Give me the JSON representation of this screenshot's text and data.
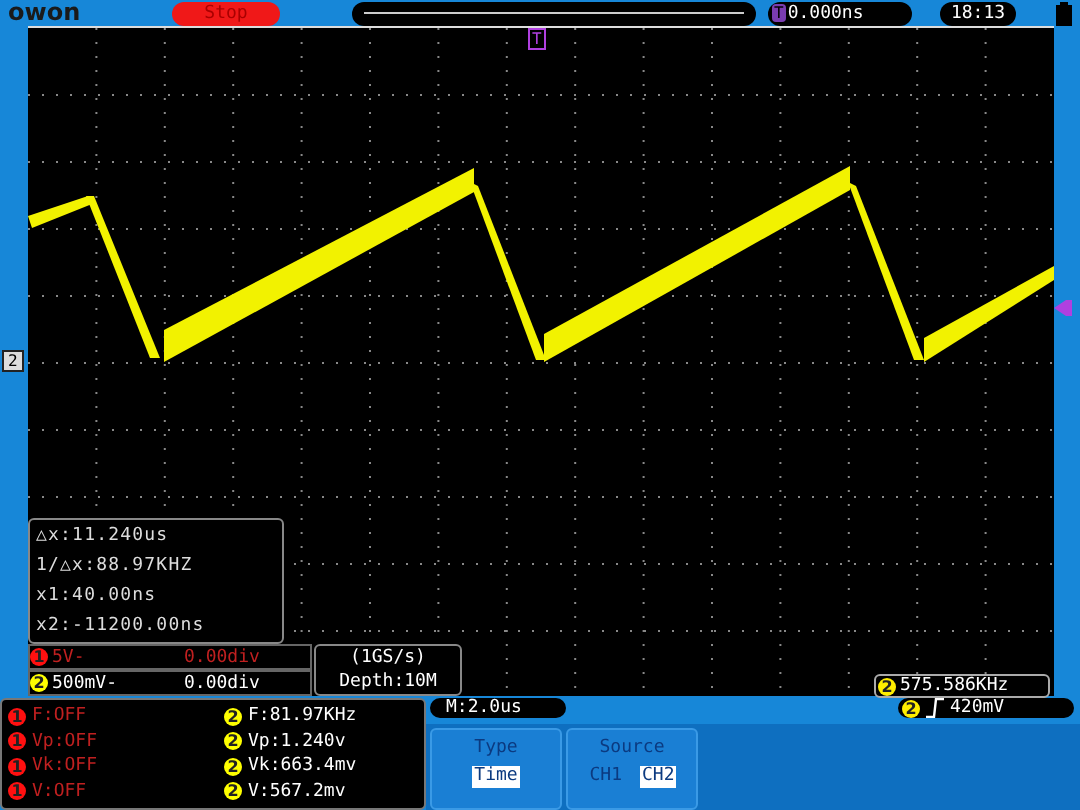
{
  "header": {
    "logo": "owon",
    "run_state": "Stop",
    "trigger_marker": "T",
    "trigger_time": "0.000ns",
    "clock": "18:13"
  },
  "display": {
    "ground_marker": "2",
    "top_marker": "T",
    "cursor_readout": [
      "△x:11.240us",
      "1/△x:88.97KHZ",
      "x1:40.00ns",
      "x2:-11200.00ns"
    ],
    "channels": [
      {
        "number": "1",
        "scale": "5V-",
        "offset": "0.00div",
        "color": "#ff1010",
        "enabled": false
      },
      {
        "number": "2",
        "scale": "500mV-",
        "offset": "0.00div",
        "color": "#ffff00",
        "enabled": true
      }
    ],
    "sample_rate": "(1GS/s)",
    "depth": "Depth:10M",
    "frequency": {
      "channel": "2",
      "value": "575.586KHz"
    }
  },
  "measurements": [
    {
      "channel": "1",
      "color": "#ff1010",
      "enabled": false,
      "value": "F:OFF"
    },
    {
      "channel": "1",
      "color": "#ff1010",
      "enabled": false,
      "value": "Vp:OFF"
    },
    {
      "channel": "1",
      "color": "#ff1010",
      "enabled": false,
      "value": "Vk:OFF"
    },
    {
      "channel": "1",
      "color": "#ff1010",
      "enabled": false,
      "value": "V:OFF"
    },
    {
      "channel": "2",
      "color": "#ffff00",
      "enabled": true,
      "value": "F:81.97KHz"
    },
    {
      "channel": "2",
      "color": "#ffff00",
      "enabled": true,
      "value": "Vp:1.240v"
    },
    {
      "channel": "2",
      "color": "#ffff00",
      "enabled": true,
      "value": "Vk:663.4mv"
    },
    {
      "channel": "2",
      "color": "#ffff00",
      "enabled": true,
      "value": "V:567.2mv"
    }
  ],
  "timebase": "M:2.0us",
  "trigger": {
    "channel": "2",
    "trigger_level": "420mV"
  },
  "menu": [
    {
      "title": "Type",
      "options": [
        {
          "label": "Time",
          "selected": true
        }
      ]
    },
    {
      "title": "Source",
      "options": [
        {
          "label": "CH1",
          "selected": false
        },
        {
          "label": "CH2",
          "selected": true
        }
      ]
    }
  ]
}
